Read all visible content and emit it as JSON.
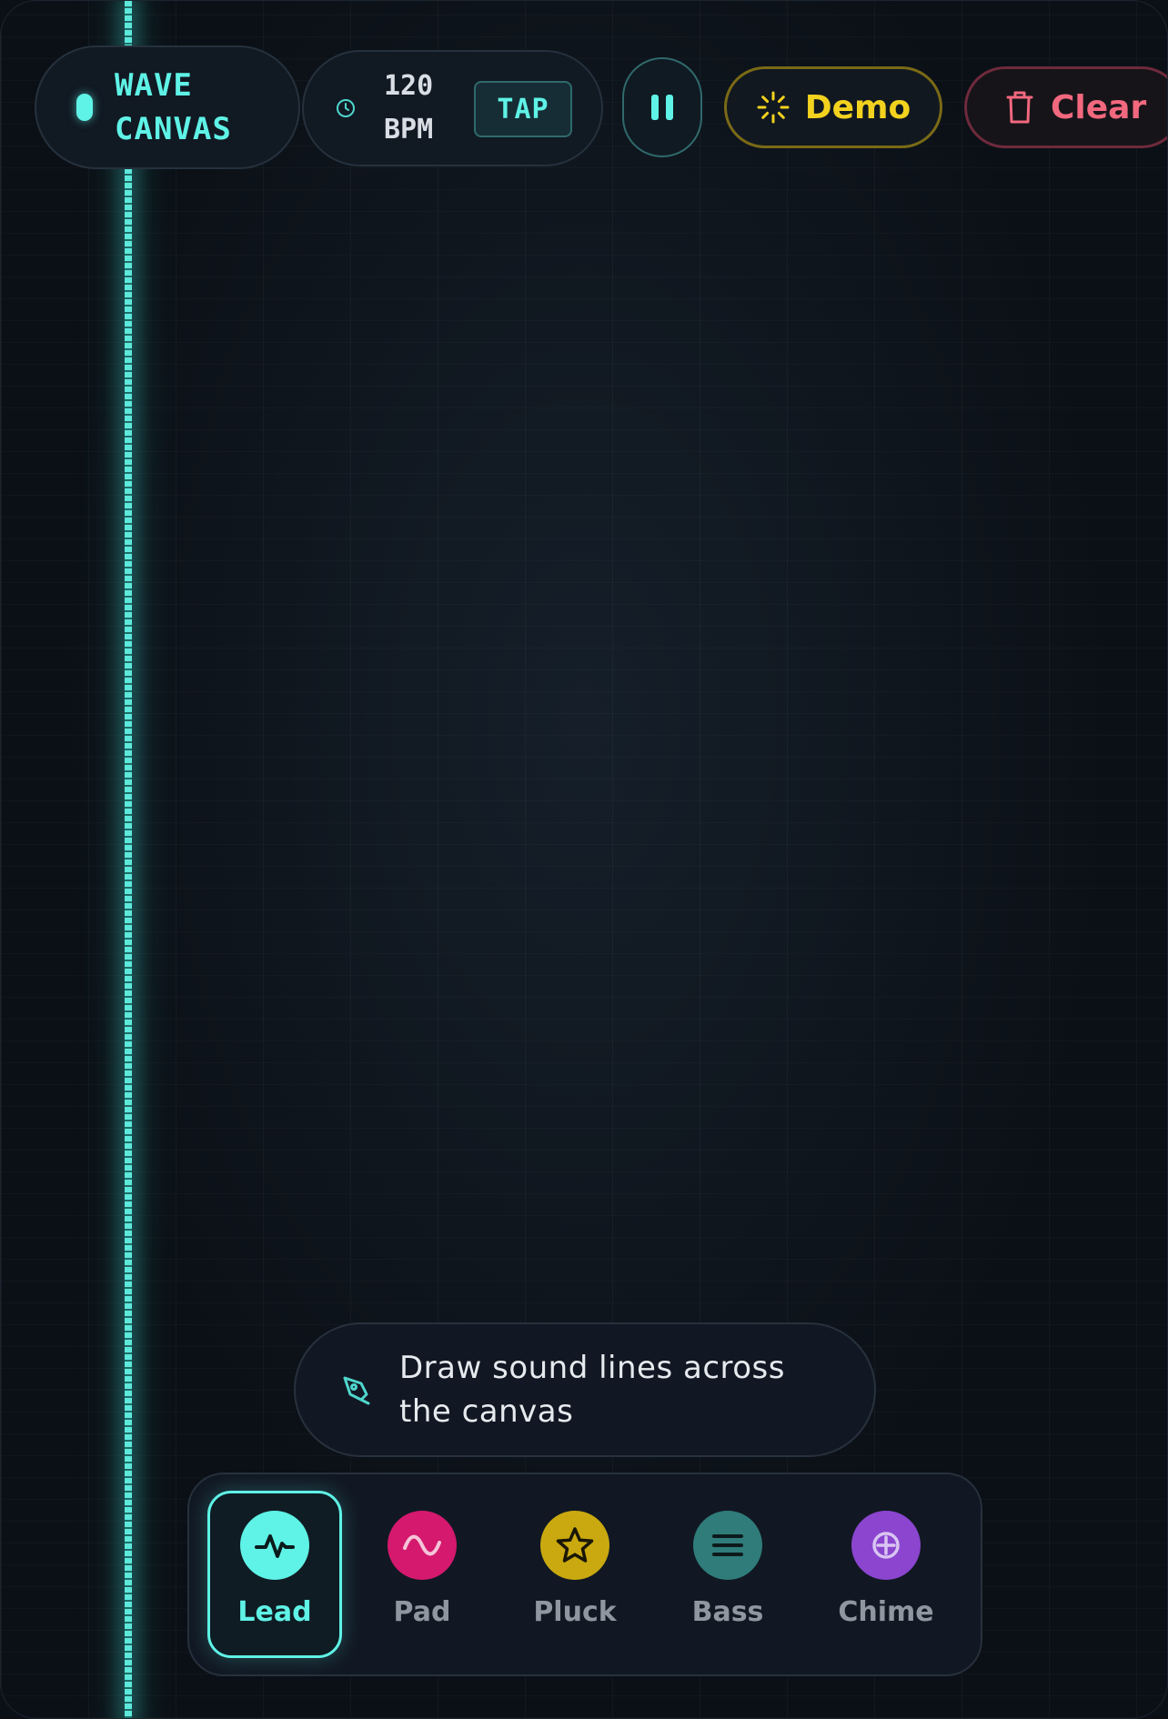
{
  "brand": {
    "line1": "WAVE",
    "line2": "CANVAS",
    "color": "#5ff2e6"
  },
  "tempo": {
    "value": "120",
    "unit": "BPM",
    "tap_label": "TAP",
    "icon": "clock-icon"
  },
  "transport": {
    "state_icon": "pause-icon"
  },
  "actions": {
    "demo_label": "Demo",
    "demo_icon": "sparkle-icon",
    "demo_color": "#f2d21e",
    "clear_label": "Clear",
    "clear_icon": "trash-icon",
    "clear_color": "#f2687e"
  },
  "hint": {
    "text": "Draw sound lines across the canvas",
    "icon": "pen-icon"
  },
  "instruments": [
    {
      "label": "Lead",
      "icon": "pulse-icon",
      "color": "#5ff2e6",
      "selected": true
    },
    {
      "label": "Pad",
      "icon": "sine-wave-icon",
      "color": "#d4196e",
      "selected": false
    },
    {
      "label": "Pluck",
      "icon": "star-icon",
      "color": "#c9a90f",
      "selected": false
    },
    {
      "label": "Bass",
      "icon": "bars-icon",
      "color": "#2f7c7a",
      "selected": false
    },
    {
      "label": "Chime",
      "icon": "crosshair-circle-icon",
      "color": "#8b45cf",
      "selected": false
    }
  ]
}
